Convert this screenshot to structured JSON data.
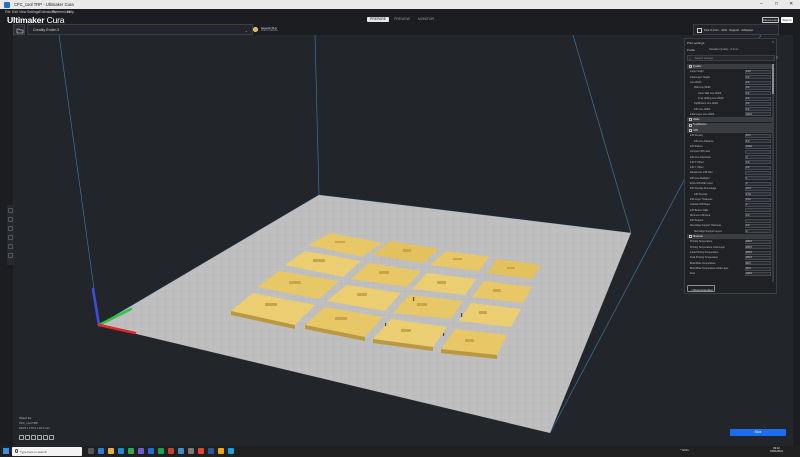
{
  "window": {
    "title": "CFC_cool TRP - Ultimaker Cura",
    "controls": [
      "–",
      "□",
      "✕"
    ]
  },
  "menu": [
    "File",
    "Edit",
    "View",
    "Settings",
    "Extensions",
    "Preferences",
    "Help"
  ],
  "header": {
    "logo_bold": "Ultimaker",
    "logo_light": " Cura",
    "stages": [
      "PREPARE",
      "PREVIEW",
      "MONITOR"
    ],
    "active_stage": "PREPARE",
    "marketplace": "Marketplace",
    "signin": "Sign in"
  },
  "toolbar": {
    "printer": "Creality Ender-3",
    "material_line1": "Generic PLA",
    "material_line2": "0.4mm Nozzle",
    "printset_summary": "Fine 0.1mm  ·  10%  ·  Support  ·  Adhesion"
  },
  "panel": {
    "title": "Print settings",
    "profile_label": "Profile",
    "profile_value": "Standard Quality - 0.2mm",
    "search_placeholder": "Search settings",
    "sections": [
      {
        "name": "Quality",
        "rows": [
          {
            "label": "Layer Height",
            "value": "0.12"
          },
          {
            "label": "Initial Layer Height",
            "value": "0.2"
          },
          {
            "label": "Line Width",
            "value": "0.4"
          },
          {
            "label": "Wall Line Width",
            "value": "0.4",
            "indent": 1
          },
          {
            "label": "Outer Wall Line Width",
            "value": "0.4",
            "indent": 2
          },
          {
            "label": "Inner Wall(s) Line Width",
            "value": "0.4",
            "indent": 2
          },
          {
            "label": "Top/Bottom Line Width",
            "value": "0.4",
            "indent": 1
          },
          {
            "label": "Infill Line Width",
            "value": "0.4",
            "indent": 1
          },
          {
            "label": "Initial Layer Line Width",
            "value": "100.0"
          }
        ]
      },
      {
        "name": "Walls",
        "rows": []
      },
      {
        "name": "Top/Bottom",
        "rows": []
      },
      {
        "name": "Infill",
        "rows": [
          {
            "label": "Infill Density",
            "value": "10.0"
          },
          {
            "label": "Infill Line Distance",
            "value": "8.0",
            "indent": 1
          },
          {
            "label": "Infill Pattern",
            "value": "Cubic"
          },
          {
            "label": "Connect Infill Lines",
            "value": ""
          },
          {
            "label": "Infill Line Directions",
            "value": "[ ]"
          },
          {
            "label": "Infill X Offset",
            "value": "0.0"
          },
          {
            "label": "Infill Y Offset",
            "value": "0.0"
          },
          {
            "label": "Randomize Infill Start",
            "value": ""
          },
          {
            "label": "Infill Line Multiplier",
            "value": "1"
          },
          {
            "label": "Extra Infill Wall Count",
            "value": "0"
          },
          {
            "label": "Infill Overlap Percentage",
            "value": "10.0"
          },
          {
            "label": "Infill Overlap",
            "value": "0.04",
            "indent": 1
          },
          {
            "label": "Infill Layer Thickness",
            "value": "0.12"
          },
          {
            "label": "Gradual Infill Steps",
            "value": "0"
          },
          {
            "label": "Infill Before Walls",
            "value": ""
          },
          {
            "label": "Minimum Infill Area",
            "value": "0.0"
          },
          {
            "label": "Infill Support",
            "value": ""
          },
          {
            "label": "Skin Edge Support Thickness",
            "value": "0.0"
          },
          {
            "label": "Skin Edge Support Layers",
            "value": "0",
            "indent": 1
          }
        ]
      },
      {
        "name": "Material",
        "rows": [
          {
            "label": "Printing Temperature",
            "value": "200.0"
          },
          {
            "label": "Printing Temperature Initial Layer",
            "value": "200.0"
          },
          {
            "label": "Initial Printing Temperature",
            "value": "200.0"
          },
          {
            "label": "Final Printing Temperature",
            "value": "200.0"
          },
          {
            "label": "Build Plate Temperature",
            "value": "60.0"
          },
          {
            "label": "Build Plate Temperature Initial Layer",
            "value": "60.0"
          },
          {
            "label": "Flow",
            "value": "100.0"
          }
        ]
      }
    ],
    "recommended_button": "< Recommended"
  },
  "object_info": {
    "list_label": "Object list",
    "file_name": "CFC_cool TRP",
    "dimensions": "194.5 x 175.4 x 10.0 mm"
  },
  "slice_button": "Slice",
  "taskbar": {
    "search_placeholder": "Type here to search",
    "tray_text": "^  ENG",
    "time": "09:12",
    "date": "16/01/2021"
  },
  "colors": {
    "accent": "#196ef0",
    "model": "#e8c766",
    "bed": "#bfbfbf"
  }
}
